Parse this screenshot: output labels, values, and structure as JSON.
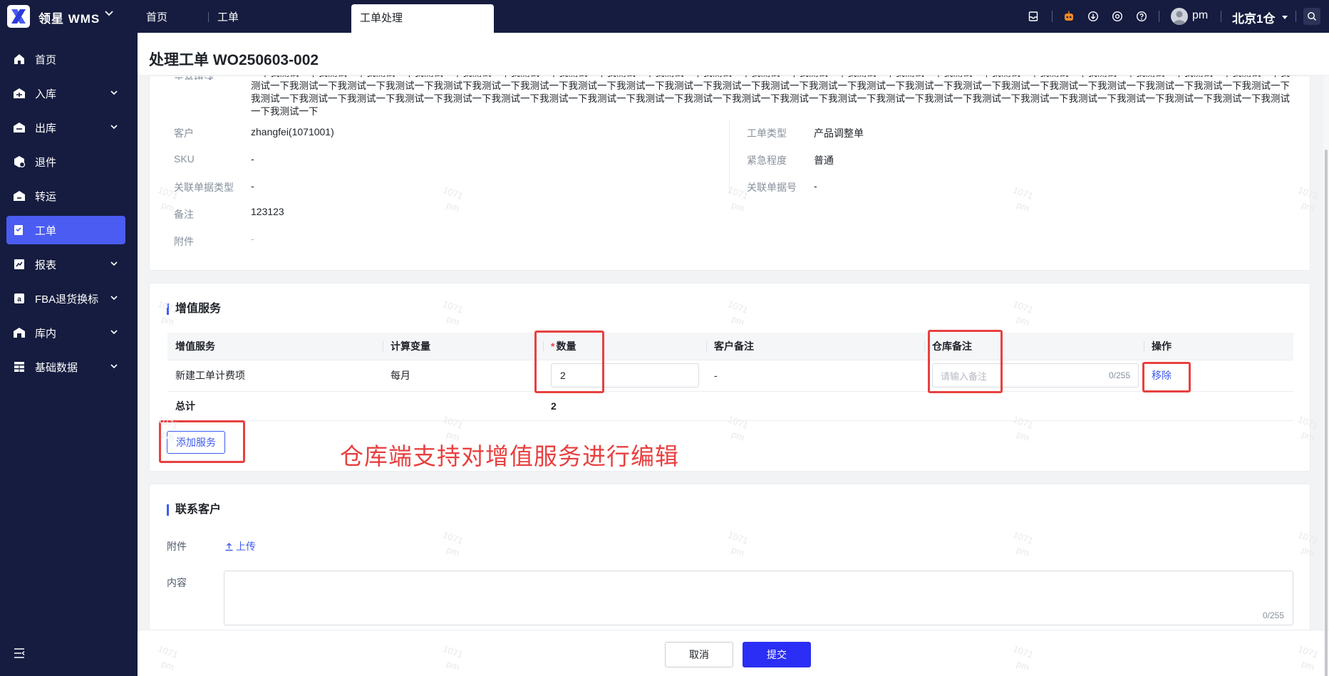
{
  "topbar": {
    "brand": "领星  WMS",
    "tabs": [
      {
        "label": "首页"
      },
      {
        "label": "工单"
      },
      {
        "label": "工单处理"
      }
    ],
    "user": "pm",
    "warehouse": "北京1仓"
  },
  "sidebar": {
    "items": [
      {
        "label": "首页",
        "icon": "home-icon"
      },
      {
        "label": "入库",
        "icon": "inbound-icon"
      },
      {
        "label": "出库",
        "icon": "outbound-icon"
      },
      {
        "label": "退件",
        "icon": "return-icon"
      },
      {
        "label": "转运",
        "icon": "transfer-icon"
      },
      {
        "label": "工单",
        "icon": "workorder-icon"
      },
      {
        "label": "报表",
        "icon": "report-icon"
      },
      {
        "label": "FBA退货换标",
        "icon": "amazon-icon"
      },
      {
        "label": "库内",
        "icon": "warehouse-icon"
      },
      {
        "label": "基础数据",
        "icon": "grid-icon"
      }
    ],
    "active_index": 5
  },
  "page": {
    "title": "处理工单 WO250603-002"
  },
  "details": {
    "partial_label": "工单描述",
    "long_text": "一下我测试一下我测试一下我测试一下我测试一下我测试一下我测试一下我测试一下我测试一下我测试一下我测试一下我测试一下我测试一下我测试一下我测试一下我测试一下我测试一下我测试一下我测试一下我测试一下我测试一下我测试一下我测试一下我测试一下我测试一下我测试一下我测试下我测试一下我测试一下我测试一下我测试一下我测试一下我测试一下我测试一下我测试一下我测试一下我测试一下我测试一下我测试一下我测试一下我测试一下我测试一下我测试一下我测试一下我测试一下我测试一下我测试一下我测试一下我测试一下我测试一下我测试一下我测试一下我测试一下我测试一下我测试一下我测试一下我测试一下我测试一下我测试一下我测试一下我测试一下我测试一下我测试一下我测试一下我测试一下我测试一下我测试一下",
    "left": [
      {
        "label": "客户",
        "value": "zhangfei(1071001)"
      },
      {
        "label": "SKU",
        "value": "-"
      },
      {
        "label": "关联单据类型",
        "value": "-"
      },
      {
        "label": "备注",
        "value": "123123"
      },
      {
        "label": "附件",
        "value": "-"
      }
    ],
    "right": [
      {
        "label": "工单类型",
        "value": "产品调整单"
      },
      {
        "label": "紧急程度",
        "value": "普通"
      },
      {
        "label": "关联单据号",
        "value": "-"
      }
    ]
  },
  "services": {
    "title": "增值服务",
    "columns": [
      "增值服务",
      "计算变量",
      "数量",
      "客户备注",
      "仓库备注",
      "操作"
    ],
    "required_mark": "*",
    "rows": [
      {
        "service": "新建工单计费项",
        "variable": "每月",
        "quantity": "2",
        "customer_note": "-",
        "warehouse_note_placeholder": "请输入备注",
        "warehouse_note_count": "0/255",
        "action": "移除"
      }
    ],
    "total_label": "总计",
    "total_quantity": "2",
    "add_button": "添加服务",
    "annotation": "仓库端支持对增值服务进行编辑"
  },
  "contact": {
    "title": "联系客户",
    "attachment_label": "附件",
    "upload_label": "上传",
    "content_label": "内容",
    "content_count": "0/255"
  },
  "footer": {
    "cancel": "取消",
    "submit": "提交"
  },
  "watermark": {
    "line1": "1071",
    "line2": "pm"
  },
  "colors": {
    "nav_bg": "#151c3f",
    "active": "#4a5cf2",
    "primary": "#2b2ef5",
    "annotation": "#e84040"
  }
}
